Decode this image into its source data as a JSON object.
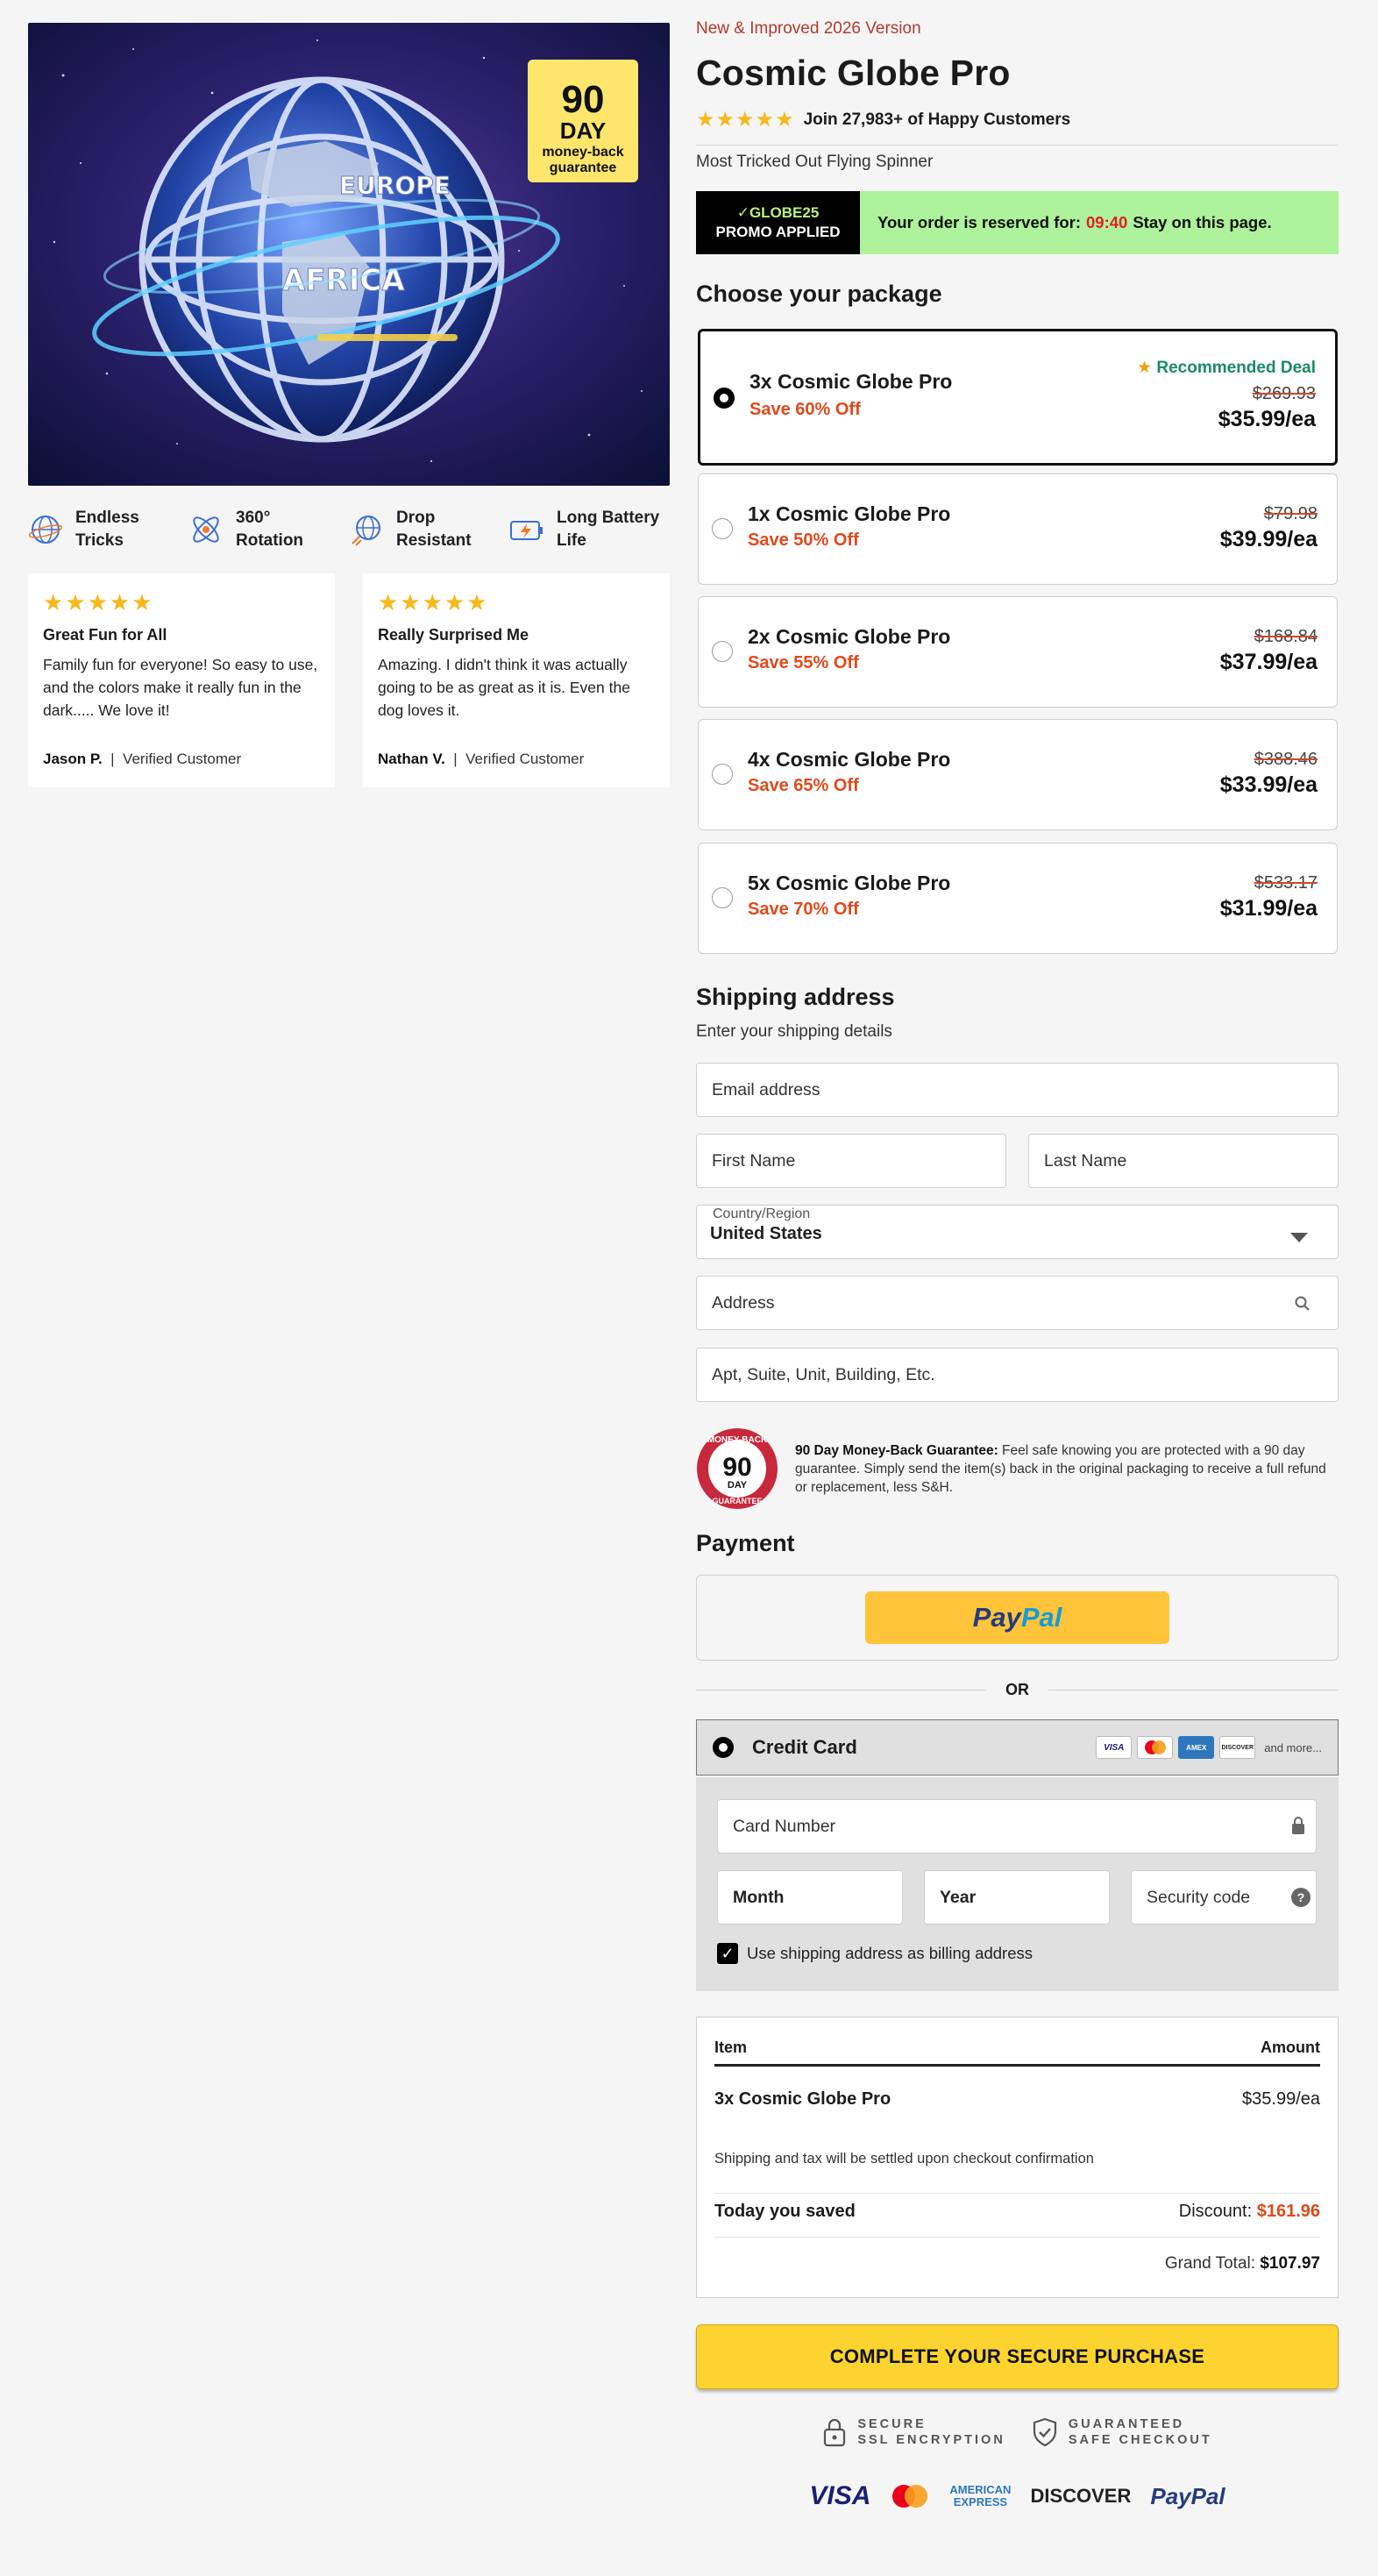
{
  "hero": {
    "badge_line1": "90",
    "badge_line2": "DAY",
    "badge_line3": "money-back",
    "badge_line4": "guarantee",
    "map_label_1": "EUROPE",
    "map_label_2": "AFRICA"
  },
  "features": [
    {
      "icon": "globe-tricks-icon",
      "label": "Endless Tricks"
    },
    {
      "icon": "rotation-icon",
      "label": "360° Rotation"
    },
    {
      "icon": "drop-resistant-icon",
      "label": "Drop Resistant"
    },
    {
      "icon": "battery-icon",
      "label": "Long Battery Life"
    }
  ],
  "reviews": [
    {
      "stars": "★★★★★",
      "title": "Great Fun for All",
      "body": "Family fun for everyone! So easy to use, and the colors make it really fun in the dark..... We love it!",
      "author": "Jason P.",
      "badge": "Verified Customer"
    },
    {
      "stars": "★★★★★",
      "title": "Really Surprised Me",
      "body": "Amazing. I didn't think it was actually going to be as great as it is. Even the dog loves it.",
      "author": "Nathan V.",
      "badge": "Verified Customer"
    }
  ],
  "product": {
    "eyebrow": "New & Improved 2026 Version",
    "title": "Cosmic Globe Pro",
    "rating_stars": "★★★★★",
    "rating_text": "Join 27,983+ of Happy Customers",
    "tagline": "Most Tricked Out Flying Spinner"
  },
  "promo": {
    "check": "✓",
    "code": "GLOBE25",
    "applied": "PROMO APPLIED",
    "reserved_prefix": "Your order is reserved for:",
    "timer": "09:40",
    "reserved_suffix": "Stay on this page."
  },
  "packages_heading": "Choose your package",
  "packages": [
    {
      "name": "3x Cosmic Globe Pro",
      "save": "Save 60% Off",
      "old": "$269.93",
      "price": "$35.99/ea",
      "badge_star": "★",
      "badge": "Recommended Deal",
      "selected": true
    },
    {
      "name": "1x Cosmic Globe Pro",
      "save": "Save 50% Off",
      "old": "$79.98",
      "price": "$39.99/ea",
      "selected": false
    },
    {
      "name": "2x Cosmic Globe Pro",
      "save": "Save 55% Off",
      "old": "$168.84",
      "price": "$37.99/ea",
      "selected": false
    },
    {
      "name": "4x Cosmic Globe Pro",
      "save": "Save 65% Off",
      "old": "$388.46",
      "price": "$33.99/ea",
      "selected": false
    },
    {
      "name": "5x Cosmic Globe Pro",
      "save": "Save 70% Off",
      "old": "$533.17",
      "price": "$31.99/ea",
      "selected": false
    }
  ],
  "shipping": {
    "heading": "Shipping address",
    "subheading": "Enter your shipping details",
    "email_placeholder": "Email address",
    "first_placeholder": "First Name",
    "last_placeholder": "Last Name",
    "country_label": "Country/Region",
    "country_value": "United States",
    "address_placeholder": "Address",
    "apt_placeholder": "Apt, Suite, Unit, Building, Etc."
  },
  "guarantee": {
    "seal_top": "MONEY-BACK",
    "seal_num": "90",
    "seal_day": "DAY",
    "seal_bottom": "GUARANTEE",
    "title": "90 Day Money-Back Guarantee:",
    "body": " Feel safe knowing you are protected with a 90 day guarantee. Simply send the item(s) back in the original packaging to receive a full refund or replacement, less S&H."
  },
  "payment": {
    "heading": "Payment",
    "paypal_1": "Pay",
    "paypal_2": "Pal",
    "or": "OR",
    "cc_label": "Credit Card",
    "card_visa": "VISA",
    "card_amex": "AMEX",
    "card_discover": "DISCOVER",
    "cards_more": "and more...",
    "card_number_placeholder": "Card Number",
    "month_placeholder": "Month",
    "year_placeholder": "Year",
    "cvv_placeholder": "Security code",
    "cvv_help": "?",
    "billing_check": "✓",
    "billing_label": "Use shipping address as billing address"
  },
  "summary": {
    "col_item": "Item",
    "col_amount": "Amount",
    "item_name": "3x Cosmic Globe Pro",
    "item_price": "$35.99/ea",
    "note": "Shipping and tax will be settled upon checkout confirmation",
    "saved_label": "Today you saved",
    "discount_label": "Discount:",
    "discount_value": "$161.96",
    "grand_label": "Grand Total:",
    "grand_value": "$107.97"
  },
  "cta_label": "COMPLETE YOUR SECURE PURCHASE",
  "trust": {
    "ssl_1": "SECURE",
    "ssl_2": "SSL ENCRYPTION",
    "safe_1": "GUARANTEED",
    "safe_2": "SAFE CHECKOUT"
  },
  "footer_logos": {
    "visa": "VISA",
    "amex_1": "AMERICAN",
    "amex_2": "EXPRESS",
    "discover": "DISCOVER",
    "paypal": "PayPal"
  },
  "colors": {
    "accent_red": "#e04a1c",
    "promo_green": "#aef29b",
    "cta_yellow": "#fdd42f",
    "star_gold": "#f6b81b",
    "rec_green": "#1a8a6a"
  }
}
